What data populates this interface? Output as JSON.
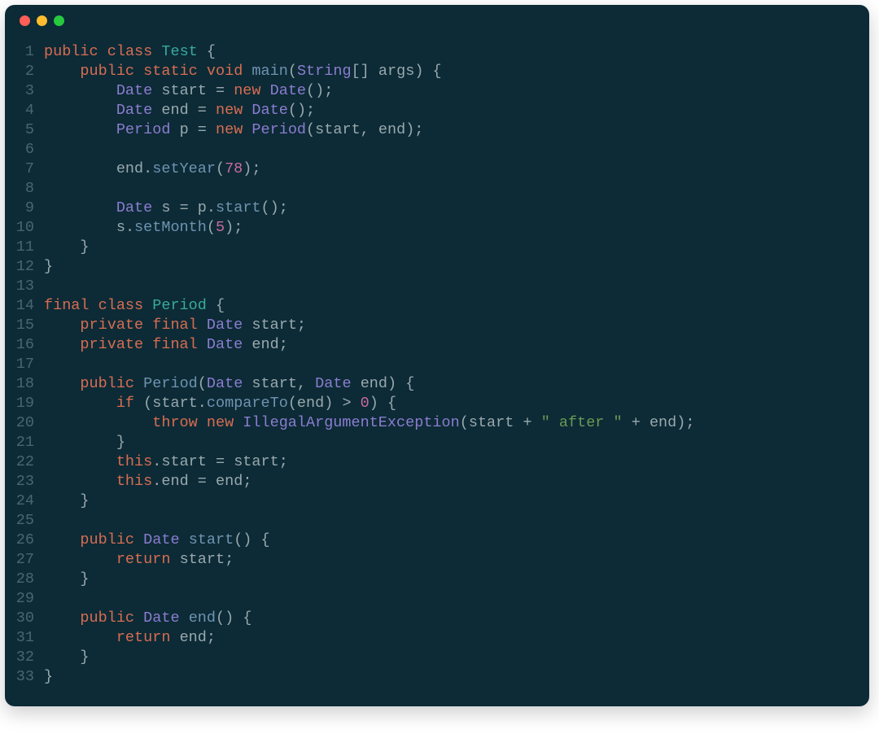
{
  "window": {
    "dots": [
      "red",
      "yellow",
      "green"
    ]
  },
  "colors": {
    "background": "#0c2b36",
    "gutter": "#4a6570",
    "keyword": "#d86c52",
    "type": "#3aa99f",
    "type2": "#8c7cd0",
    "func": "#6f93b0",
    "id": "#9aa8ad",
    "num": "#c9699e",
    "str": "#6a9955"
  },
  "code": {
    "line_count": 33,
    "lines": [
      {
        "n": 1,
        "t": [
          [
            "kw",
            "public"
          ],
          [
            "",
            null
          ],
          [
            "kw",
            "class"
          ],
          [
            "",
            null
          ],
          [
            "type",
            "Test"
          ],
          [
            "",
            null
          ],
          [
            "punc",
            "{"
          ]
        ]
      },
      {
        "n": 2,
        "t": [
          [
            "",
            "    "
          ],
          [
            "kw",
            "public"
          ],
          [
            "",
            null
          ],
          [
            "kw",
            "static"
          ],
          [
            "",
            null
          ],
          [
            "kw",
            "void"
          ],
          [
            "",
            null
          ],
          [
            "func",
            "main"
          ],
          [
            "punc",
            "("
          ],
          [
            "type2",
            "String"
          ],
          [
            "punc",
            "[]"
          ],
          [
            "",
            null
          ],
          [
            "id",
            "args"
          ],
          [
            "punc",
            ")"
          ],
          [
            "",
            null
          ],
          [
            "punc",
            "{"
          ]
        ]
      },
      {
        "n": 3,
        "t": [
          [
            "",
            "        "
          ],
          [
            "type2",
            "Date"
          ],
          [
            "",
            null
          ],
          [
            "id",
            "start"
          ],
          [
            "",
            null
          ],
          [
            "punc",
            "="
          ],
          [
            "",
            null
          ],
          [
            "kw",
            "new"
          ],
          [
            "",
            null
          ],
          [
            "type2",
            "Date"
          ],
          [
            "punc",
            "();"
          ]
        ]
      },
      {
        "n": 4,
        "t": [
          [
            "",
            "        "
          ],
          [
            "type2",
            "Date"
          ],
          [
            "",
            null
          ],
          [
            "id",
            "end"
          ],
          [
            "",
            null
          ],
          [
            "punc",
            "="
          ],
          [
            "",
            null
          ],
          [
            "kw",
            "new"
          ],
          [
            "",
            null
          ],
          [
            "type2",
            "Date"
          ],
          [
            "punc",
            "();"
          ]
        ]
      },
      {
        "n": 5,
        "t": [
          [
            "",
            "        "
          ],
          [
            "type2",
            "Period"
          ],
          [
            "",
            null
          ],
          [
            "id",
            "p"
          ],
          [
            "",
            null
          ],
          [
            "punc",
            "="
          ],
          [
            "",
            null
          ],
          [
            "kw",
            "new"
          ],
          [
            "",
            null
          ],
          [
            "type2",
            "Period"
          ],
          [
            "punc",
            "("
          ],
          [
            "id",
            "start"
          ],
          [
            "punc",
            ","
          ],
          [
            "",
            null
          ],
          [
            "id",
            "end"
          ],
          [
            "punc",
            ");"
          ]
        ]
      },
      {
        "n": 6,
        "t": []
      },
      {
        "n": 7,
        "t": [
          [
            "",
            "        "
          ],
          [
            "id",
            "end"
          ],
          [
            "punc",
            "."
          ],
          [
            "func",
            "setYear"
          ],
          [
            "punc",
            "("
          ],
          [
            "num",
            "78"
          ],
          [
            "punc",
            ");"
          ]
        ]
      },
      {
        "n": 8,
        "t": []
      },
      {
        "n": 9,
        "t": [
          [
            "",
            "        "
          ],
          [
            "type2",
            "Date"
          ],
          [
            "",
            null
          ],
          [
            "id",
            "s"
          ],
          [
            "",
            null
          ],
          [
            "punc",
            "="
          ],
          [
            "",
            null
          ],
          [
            "id",
            "p"
          ],
          [
            "punc",
            "."
          ],
          [
            "func",
            "start"
          ],
          [
            "punc",
            "();"
          ]
        ]
      },
      {
        "n": 10,
        "t": [
          [
            "",
            "        "
          ],
          [
            "id",
            "s"
          ],
          [
            "punc",
            "."
          ],
          [
            "func",
            "setMonth"
          ],
          [
            "punc",
            "("
          ],
          [
            "num",
            "5"
          ],
          [
            "punc",
            ");"
          ]
        ]
      },
      {
        "n": 11,
        "t": [
          [
            "",
            "    "
          ],
          [
            "punc",
            "}"
          ]
        ]
      },
      {
        "n": 12,
        "t": [
          [
            "punc",
            "}"
          ]
        ]
      },
      {
        "n": 13,
        "t": []
      },
      {
        "n": 14,
        "t": [
          [
            "kw",
            "final"
          ],
          [
            "",
            null
          ],
          [
            "kw",
            "class"
          ],
          [
            "",
            null
          ],
          [
            "type",
            "Period"
          ],
          [
            "",
            null
          ],
          [
            "punc",
            "{"
          ]
        ]
      },
      {
        "n": 15,
        "t": [
          [
            "",
            "    "
          ],
          [
            "kw",
            "private"
          ],
          [
            "",
            null
          ],
          [
            "kw",
            "final"
          ],
          [
            "",
            null
          ],
          [
            "type2",
            "Date"
          ],
          [
            "",
            null
          ],
          [
            "id",
            "start"
          ],
          [
            "punc",
            ";"
          ]
        ]
      },
      {
        "n": 16,
        "t": [
          [
            "",
            "    "
          ],
          [
            "kw",
            "private"
          ],
          [
            "",
            null
          ],
          [
            "kw",
            "final"
          ],
          [
            "",
            null
          ],
          [
            "type2",
            "Date"
          ],
          [
            "",
            null
          ],
          [
            "id",
            "end"
          ],
          [
            "punc",
            ";"
          ]
        ]
      },
      {
        "n": 17,
        "t": []
      },
      {
        "n": 18,
        "t": [
          [
            "",
            "    "
          ],
          [
            "kw",
            "public"
          ],
          [
            "",
            null
          ],
          [
            "func",
            "Period"
          ],
          [
            "punc",
            "("
          ],
          [
            "type2",
            "Date"
          ],
          [
            "",
            null
          ],
          [
            "id",
            "start"
          ],
          [
            "punc",
            ","
          ],
          [
            "",
            null
          ],
          [
            "type2",
            "Date"
          ],
          [
            "",
            null
          ],
          [
            "id",
            "end"
          ],
          [
            "punc",
            ")"
          ],
          [
            "",
            null
          ],
          [
            "punc",
            "{"
          ]
        ]
      },
      {
        "n": 19,
        "t": [
          [
            "",
            "        "
          ],
          [
            "kw",
            "if"
          ],
          [
            "",
            null
          ],
          [
            "punc",
            "("
          ],
          [
            "id",
            "start"
          ],
          [
            "punc",
            "."
          ],
          [
            "func",
            "compareTo"
          ],
          [
            "punc",
            "("
          ],
          [
            "id",
            "end"
          ],
          [
            "punc",
            ")"
          ],
          [
            "",
            null
          ],
          [
            "punc",
            ">"
          ],
          [
            "",
            null
          ],
          [
            "num",
            "0"
          ],
          [
            "punc",
            ")"
          ],
          [
            "",
            null
          ],
          [
            "punc",
            "{"
          ]
        ]
      },
      {
        "n": 20,
        "t": [
          [
            "",
            "            "
          ],
          [
            "kw",
            "throw"
          ],
          [
            "",
            null
          ],
          [
            "kw",
            "new"
          ],
          [
            "",
            null
          ],
          [
            "type2",
            "IllegalArgumentException"
          ],
          [
            "punc",
            "("
          ],
          [
            "id",
            "start"
          ],
          [
            "",
            null
          ],
          [
            "punc",
            "+"
          ],
          [
            "",
            null
          ],
          [
            "str",
            "\" after \""
          ],
          [
            "",
            null
          ],
          [
            "punc",
            "+"
          ],
          [
            "",
            null
          ],
          [
            "id",
            "end"
          ],
          [
            "punc",
            ");"
          ]
        ]
      },
      {
        "n": 21,
        "t": [
          [
            "",
            "        "
          ],
          [
            "punc",
            "}"
          ]
        ]
      },
      {
        "n": 22,
        "t": [
          [
            "",
            "        "
          ],
          [
            "kw",
            "this"
          ],
          [
            "punc",
            "."
          ],
          [
            "id",
            "start"
          ],
          [
            "",
            null
          ],
          [
            "punc",
            "="
          ],
          [
            "",
            null
          ],
          [
            "id",
            "start"
          ],
          [
            "punc",
            ";"
          ]
        ]
      },
      {
        "n": 23,
        "t": [
          [
            "",
            "        "
          ],
          [
            "kw",
            "this"
          ],
          [
            "punc",
            "."
          ],
          [
            "id",
            "end"
          ],
          [
            "",
            null
          ],
          [
            "punc",
            "="
          ],
          [
            "",
            null
          ],
          [
            "id",
            "end"
          ],
          [
            "punc",
            ";"
          ]
        ]
      },
      {
        "n": 24,
        "t": [
          [
            "",
            "    "
          ],
          [
            "punc",
            "}"
          ]
        ]
      },
      {
        "n": 25,
        "t": []
      },
      {
        "n": 26,
        "t": [
          [
            "",
            "    "
          ],
          [
            "kw",
            "public"
          ],
          [
            "",
            null
          ],
          [
            "type2",
            "Date"
          ],
          [
            "",
            null
          ],
          [
            "func",
            "start"
          ],
          [
            "punc",
            "()"
          ],
          [
            "",
            null
          ],
          [
            "punc",
            "{"
          ]
        ]
      },
      {
        "n": 27,
        "t": [
          [
            "",
            "        "
          ],
          [
            "kw",
            "return"
          ],
          [
            "",
            null
          ],
          [
            "id",
            "start"
          ],
          [
            "punc",
            ";"
          ]
        ]
      },
      {
        "n": 28,
        "t": [
          [
            "",
            "    "
          ],
          [
            "punc",
            "}"
          ]
        ]
      },
      {
        "n": 29,
        "t": []
      },
      {
        "n": 30,
        "t": [
          [
            "",
            "    "
          ],
          [
            "kw",
            "public"
          ],
          [
            "",
            null
          ],
          [
            "type2",
            "Date"
          ],
          [
            "",
            null
          ],
          [
            "func",
            "end"
          ],
          [
            "punc",
            "()"
          ],
          [
            "",
            null
          ],
          [
            "punc",
            "{"
          ]
        ]
      },
      {
        "n": 31,
        "t": [
          [
            "",
            "        "
          ],
          [
            "kw",
            "return"
          ],
          [
            "",
            null
          ],
          [
            "id",
            "end"
          ],
          [
            "punc",
            ";"
          ]
        ]
      },
      {
        "n": 32,
        "t": [
          [
            "",
            "    "
          ],
          [
            "punc",
            "}"
          ]
        ]
      },
      {
        "n": 33,
        "t": [
          [
            "punc",
            "}"
          ]
        ]
      }
    ]
  }
}
